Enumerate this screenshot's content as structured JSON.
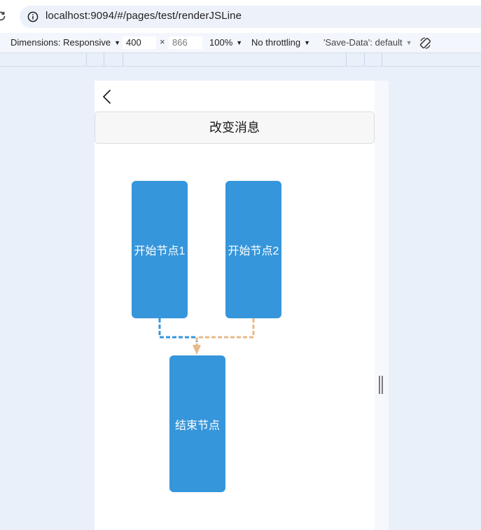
{
  "browser": {
    "url": "localhost:9094/#/pages/test/renderJSLine"
  },
  "devtools": {
    "dimensions_label": "Dimensions: Responsive",
    "width_value": "400",
    "height_value": "866",
    "times_symbol": "×",
    "zoom_label": "100%",
    "throttle_label": "No throttling",
    "save_data_label": "'Save-Data': default"
  },
  "page": {
    "change_message_button": "改变消息",
    "nodes": {
      "start1": "开始节点1",
      "start2": "开始节点2",
      "end": "结束节点"
    }
  },
  "colors": {
    "node_fill": "#3696db",
    "line_from_start1": "#3696db",
    "line_from_start2": "#e8b98a",
    "arrow": "#e8b98a"
  },
  "icons": [
    "reload-icon",
    "info-icon",
    "rotate-icon",
    "back-icon",
    "arrow-down-icon"
  ]
}
